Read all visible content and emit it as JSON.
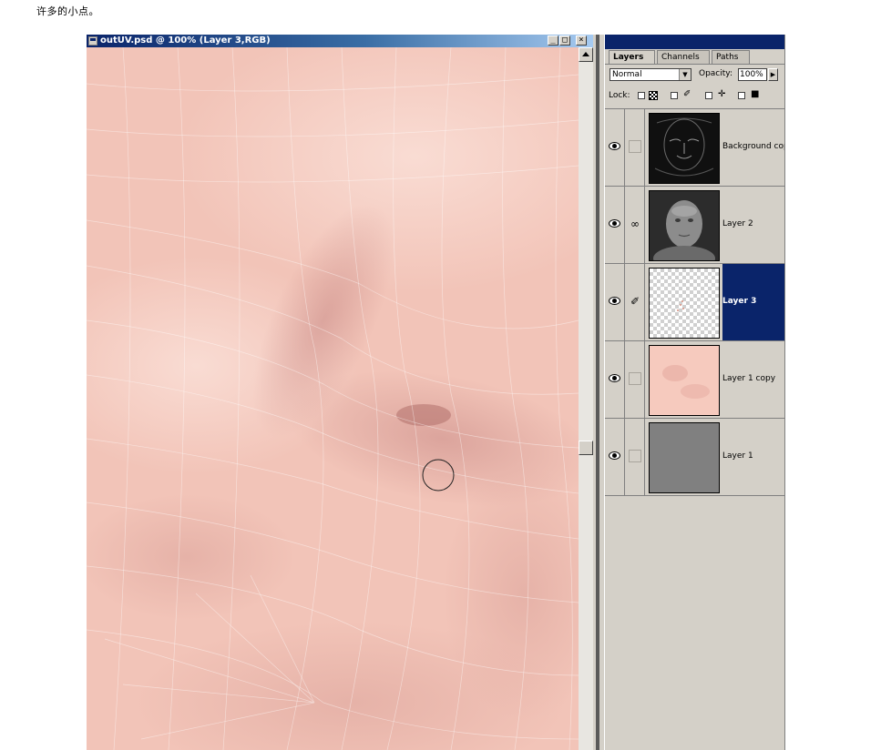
{
  "caption": "许多的小点。",
  "document": {
    "title": "outUV.psd @ 100% (Layer 3,RGB)",
    "buttons": {
      "minimize": "_",
      "maximize": "□",
      "close": "×"
    }
  },
  "palette": {
    "tabs": [
      {
        "label": "Layers",
        "active": true
      },
      {
        "label": "Channels",
        "active": false
      },
      {
        "label": "Paths",
        "active": false
      }
    ],
    "blend_mode": "Normal",
    "opacity_label": "Opacity:",
    "opacity_value": "100%",
    "lock_label": "Lock:",
    "layers": [
      {
        "name": "Background copy",
        "visible": true,
        "linked": false,
        "selected": false,
        "thumb": "dark-edge-face"
      },
      {
        "name": "Layer 2",
        "visible": true,
        "linked": true,
        "selected": false,
        "thumb": "gray-face"
      },
      {
        "name": "Layer 3",
        "visible": true,
        "linked": false,
        "brush": true,
        "selected": true,
        "thumb": "transparent"
      },
      {
        "name": "Layer 1 copy",
        "visible": true,
        "linked": false,
        "selected": false,
        "thumb": "skin"
      },
      {
        "name": "Layer 1",
        "visible": true,
        "linked": false,
        "selected": false,
        "thumb": "gray"
      }
    ]
  },
  "colors": {
    "titlebar": "#0a246a",
    "selection": "#0a246a",
    "skin": "#f2c4b8",
    "panel": "#d4d0c8"
  }
}
